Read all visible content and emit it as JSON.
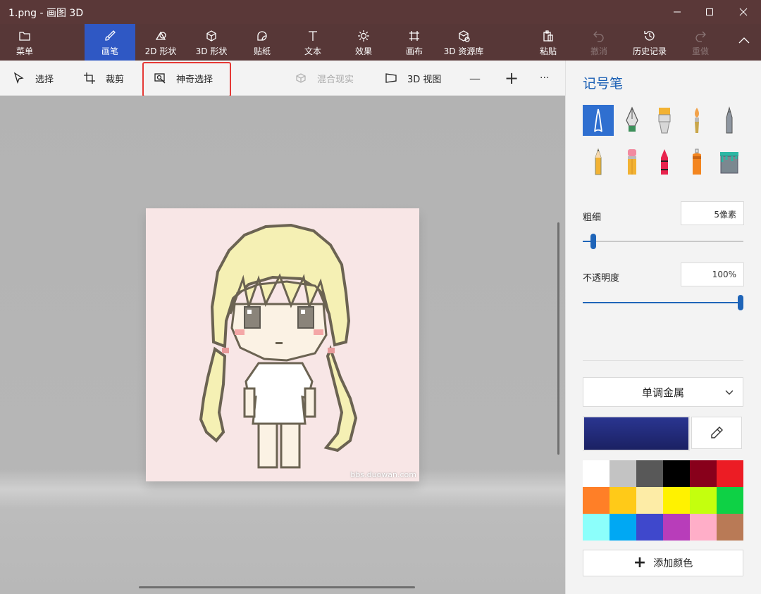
{
  "window": {
    "title": "1.png - 画图 3D"
  },
  "ribbon": {
    "menu": "菜单",
    "tabs": [
      {
        "label": "画笔",
        "icon": "brush-icon",
        "active": true
      },
      {
        "label": "2D 形状",
        "icon": "2d-shapes-icon"
      },
      {
        "label": "3D 形状",
        "icon": "3d-shapes-icon"
      },
      {
        "label": "贴纸",
        "icon": "stickers-icon"
      },
      {
        "label": "文本",
        "icon": "text-icon"
      },
      {
        "label": "效果",
        "icon": "effects-icon"
      },
      {
        "label": "画布",
        "icon": "canvas-icon"
      },
      {
        "label": "3D 资源库",
        "icon": "3d-library-icon"
      }
    ],
    "paste": "粘贴",
    "undo": "撤消",
    "history": "历史记录",
    "redo": "重做"
  },
  "toolbar": {
    "select": "选择",
    "crop": "裁剪",
    "magic_select": "神奇选择",
    "mixed_reality": "混合现实",
    "view_3d": "3D 视图",
    "zoom_out": "—",
    "zoom_in": "+",
    "more": "···"
  },
  "canvas": {
    "watermark": "bbs.duowan.com"
  },
  "panel": {
    "title": "记号笔",
    "brushes": [
      {
        "name": "marker",
        "icon": "marker-icon",
        "selected": true
      },
      {
        "name": "calligraphy-pen",
        "icon": "calligraphy-pen-icon"
      },
      {
        "name": "oil-brush",
        "icon": "oil-brush-icon"
      },
      {
        "name": "watercolor",
        "icon": "watercolor-icon"
      },
      {
        "name": "pixel-pen",
        "icon": "pixel-pen-icon"
      },
      {
        "name": "pencil",
        "icon": "pencil-icon"
      },
      {
        "name": "eraser",
        "icon": "eraser-icon"
      },
      {
        "name": "crayon",
        "icon": "crayon-icon"
      },
      {
        "name": "spray-can",
        "icon": "spray-can-icon"
      },
      {
        "name": "fill",
        "icon": "fill-bucket-icon"
      }
    ],
    "thickness_label": "粗细",
    "thickness_value": "5像素",
    "thickness_level": 0.05,
    "opacity_label": "不透明度",
    "opacity_value": "100%",
    "opacity_level": 1.0,
    "material": "单调金属",
    "current_color": "#2a3590",
    "palette": [
      "#ffffff",
      "#c3c3c3",
      "#585858",
      "#000000",
      "#88001b",
      "#ec1c24",
      "#ff7f27",
      "#ffca18",
      "#fdeca6",
      "#fff200",
      "#c4ff0e",
      "#0ed145",
      "#8cfffb",
      "#00a8f3",
      "#3f48cc",
      "#b83dba",
      "#ffaec8",
      "#b97a56"
    ],
    "add_color": "添加颜色"
  }
}
